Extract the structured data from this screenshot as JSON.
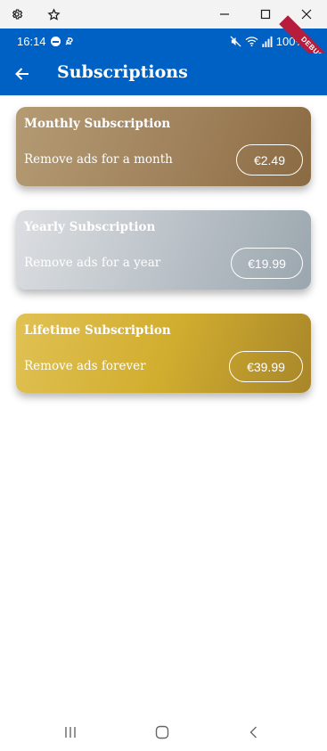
{
  "window": {
    "icons": [
      "gear-icon",
      "star-icon",
      "minimize-icon",
      "maximize-icon",
      "close-icon"
    ]
  },
  "status_bar": {
    "time": "16:14",
    "battery": "100%",
    "icons": [
      "do-not-disturb-icon",
      "link-icon",
      "mute-icon",
      "wifi-icon",
      "signal-icon",
      "battery-icon"
    ]
  },
  "debug_banner": "DEBUG",
  "app_bar": {
    "title": "Subscriptions",
    "back_icon": "arrow-left-icon"
  },
  "subscriptions": [
    {
      "title": "Monthly Subscription",
      "description": "Remove ads for a month",
      "price": "€2.49"
    },
    {
      "title": "Yearly Subscription",
      "description": "Remove ads for a year",
      "price": "€19.99"
    },
    {
      "title": "Lifetime Subscription",
      "description": "Remove ads forever",
      "price": "€39.99"
    }
  ],
  "colors": {
    "app_bar": "#0061c5",
    "monthly_card": "#a0825c",
    "yearly_card": "#bcc3c9",
    "lifetime_card": "#d2ae2f",
    "debug_ribbon": "#b71c3c"
  },
  "nav_bar": {
    "icons": [
      "recent-apps-icon",
      "home-icon",
      "back-icon"
    ]
  }
}
